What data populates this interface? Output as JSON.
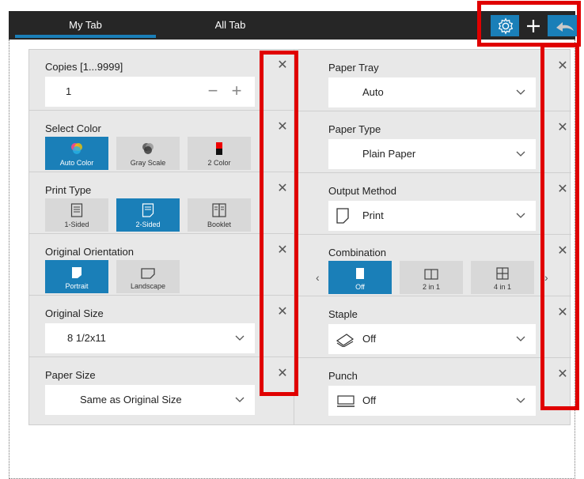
{
  "tabs": [
    {
      "label": "My Tab",
      "selected": true
    },
    {
      "label": "All Tab",
      "selected": false
    }
  ],
  "toolbar_icons": [
    "gear-icon",
    "plus-icon",
    "undo-icon"
  ],
  "accent_color": "#1a7fb8",
  "highlight_color": "#e00000",
  "left_column": {
    "copies": {
      "title": "Copies [1...9999]",
      "value": "1",
      "minus": "−",
      "plus": "+"
    },
    "select_color": {
      "title": "Select Color",
      "options": [
        "Auto Color",
        "Gray Scale",
        "2 Color"
      ],
      "selected": "Auto Color"
    },
    "print_type": {
      "title": "Print Type",
      "options": [
        "1-Sided",
        "2-Sided",
        "Booklet"
      ],
      "selected": "2-Sided"
    },
    "original_orientation": {
      "title": "Original Orientation",
      "options": [
        "Portrait",
        "Landscape"
      ],
      "selected": "Portrait"
    },
    "original_size": {
      "title": "Original Size",
      "value": "8 1/2x11"
    },
    "paper_size": {
      "title": "Paper Size",
      "value": "Same as Original Size"
    }
  },
  "right_column": {
    "paper_tray": {
      "title": "Paper Tray",
      "value": "Auto"
    },
    "paper_type": {
      "title": "Paper Type",
      "value": "Plain Paper"
    },
    "output_method": {
      "title": "Output Method",
      "value": "Print"
    },
    "combination": {
      "title": "Combination",
      "options": [
        "Off",
        "2 in 1",
        "4 in 1"
      ],
      "selected": "Off"
    },
    "staple": {
      "title": "Staple",
      "value": "Off"
    },
    "punch": {
      "title": "Punch",
      "value": "Off"
    }
  },
  "close_glyph": "✕"
}
